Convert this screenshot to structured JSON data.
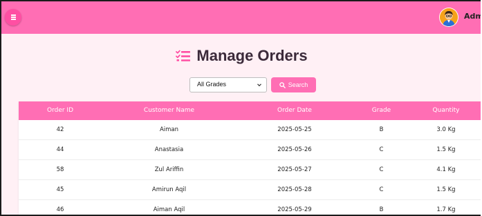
{
  "header": {
    "user_name": "Admin",
    "colors": {
      "brand": "#ff6eb4",
      "menu_button": "#ff4fa3",
      "background": "#fff0f5"
    },
    "icons": [
      "hamburger-menu-icon",
      "user-avatar-icon"
    ]
  },
  "page": {
    "title": "Manage Orders",
    "title_icon": "checklist-icon"
  },
  "filter": {
    "grade_selected": "All Grades",
    "search_label": "Search",
    "search_icon": "search-icon"
  },
  "table": {
    "columns": [
      "Order ID",
      "Customer Name",
      "Order Date",
      "Grade",
      "Quantity"
    ],
    "rows": [
      [
        "42",
        "Aiman",
        "2025-05-25",
        "B",
        "3.0 Kg"
      ],
      [
        "44",
        "Anastasia",
        "2025-05-26",
        "C",
        "1.5 Kg"
      ],
      [
        "58",
        "Zul Ariffin",
        "2025-05-27",
        "C",
        "4.1 Kg"
      ],
      [
        "45",
        "Amirun Aqil",
        "2025-05-28",
        "C",
        "1.5 Kg"
      ],
      [
        "46",
        "Aiman Aqil",
        "2025-05-29",
        "B",
        "1.7 Kg"
      ]
    ]
  }
}
